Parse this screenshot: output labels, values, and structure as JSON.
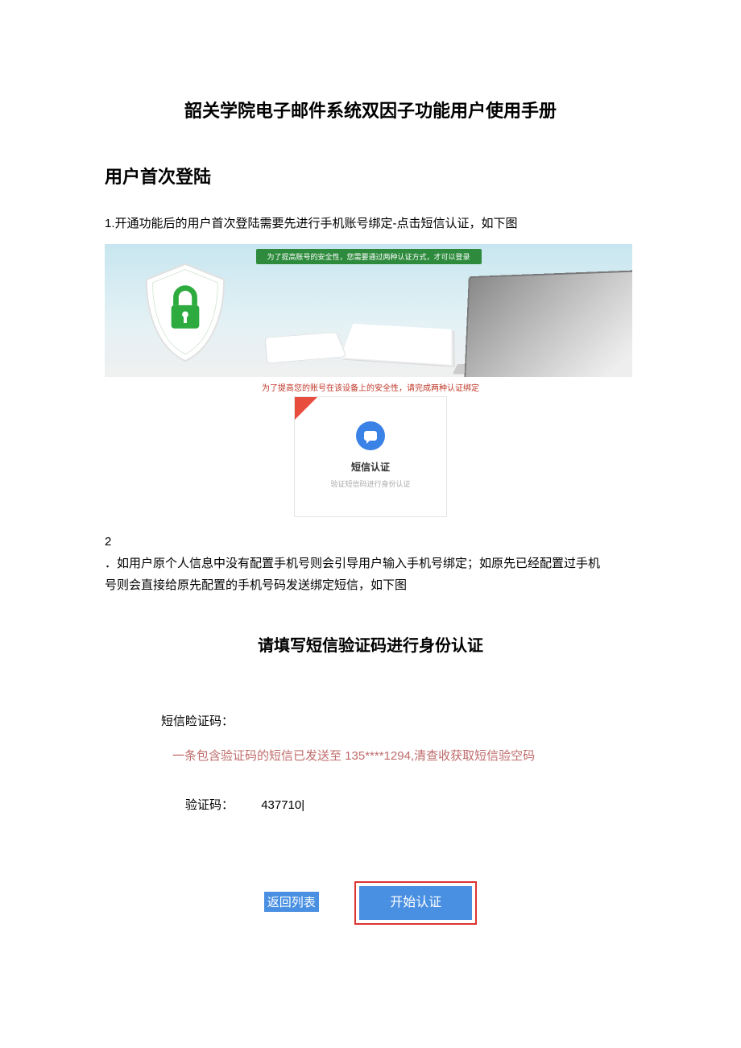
{
  "title": "韶关学院电子邮件系统双因子功能用户使用手册",
  "section1_heading": "用户首次登陆",
  "step1_text": "1.开通功能后的用户首次登陆需要先进行手机账号绑定-点击短信认证，如下图",
  "banner_green_text": "为了提高账号的安全性，您需要通过两种认证方式，才可以登录",
  "card_caption_red": "为了提高您的账号在该设备上的安全性，请完成两种认证绑定",
  "sms_card_title": "短信认证",
  "sms_card_desc": "验证短信码进行身份认证",
  "step2_num": "2",
  "step2_text": "．如用户原个人信息中没有配置手机号则会引导用户输入手机号绑定；如原先已经配置过手机号则会直接给原先配置的手机号码发送绑定短信，如下图",
  "verify_title": "请填写短信验证码进行身份认证",
  "vform_label": "短信睑证码：",
  "vform_notice": "一条包含验证码的短信已发送至 135****1294,清查收获取短信验空码",
  "vform_code_label": "验证码：",
  "vform_code_value": "437710|",
  "btn_return": "返回列表",
  "btn_start": "开始认证"
}
